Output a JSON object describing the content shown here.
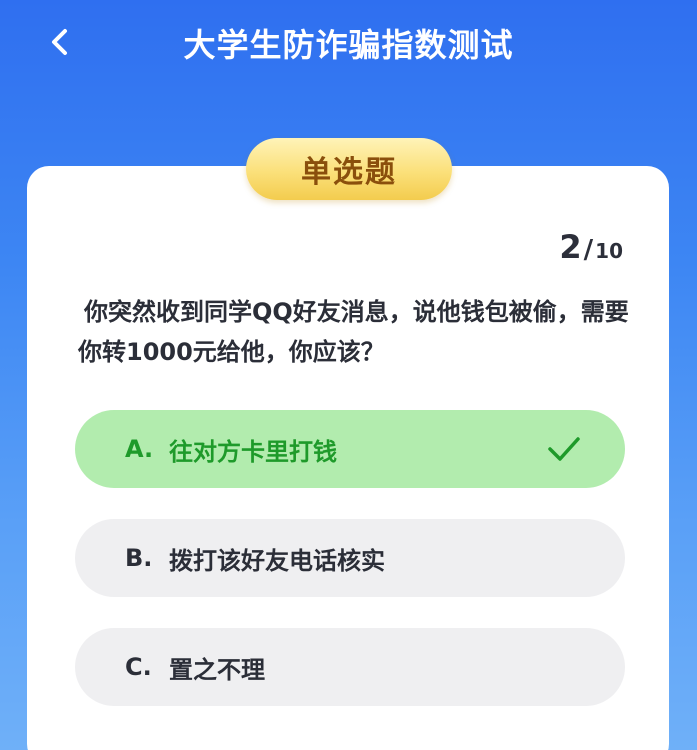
{
  "header": {
    "title": "大学生防诈骗指数测试",
    "back_icon": "chevron-left-icon"
  },
  "quiz": {
    "type_label": "单选题",
    "progress_current": "2",
    "progress_separator": "/",
    "progress_total": "10",
    "question": "你突然收到同学QQ好友消息，说他钱包被偷，需要你转1000元给他，你应该？",
    "options": [
      {
        "letter": "A.",
        "text": "往对方卡里打钱",
        "state": "selected-correct",
        "icon": "checkmark-icon"
      },
      {
        "letter": "B.",
        "text": "拨打该好友电话核实",
        "state": "default"
      },
      {
        "letter": "C.",
        "text": "置之不理",
        "state": "default"
      }
    ]
  },
  "colors": {
    "background": "#3d86f3",
    "tag": "#fbe07a",
    "selected_bg": "#b2ecae",
    "selected_text": "#1e9a2a",
    "option_bg": "#efeff1"
  }
}
